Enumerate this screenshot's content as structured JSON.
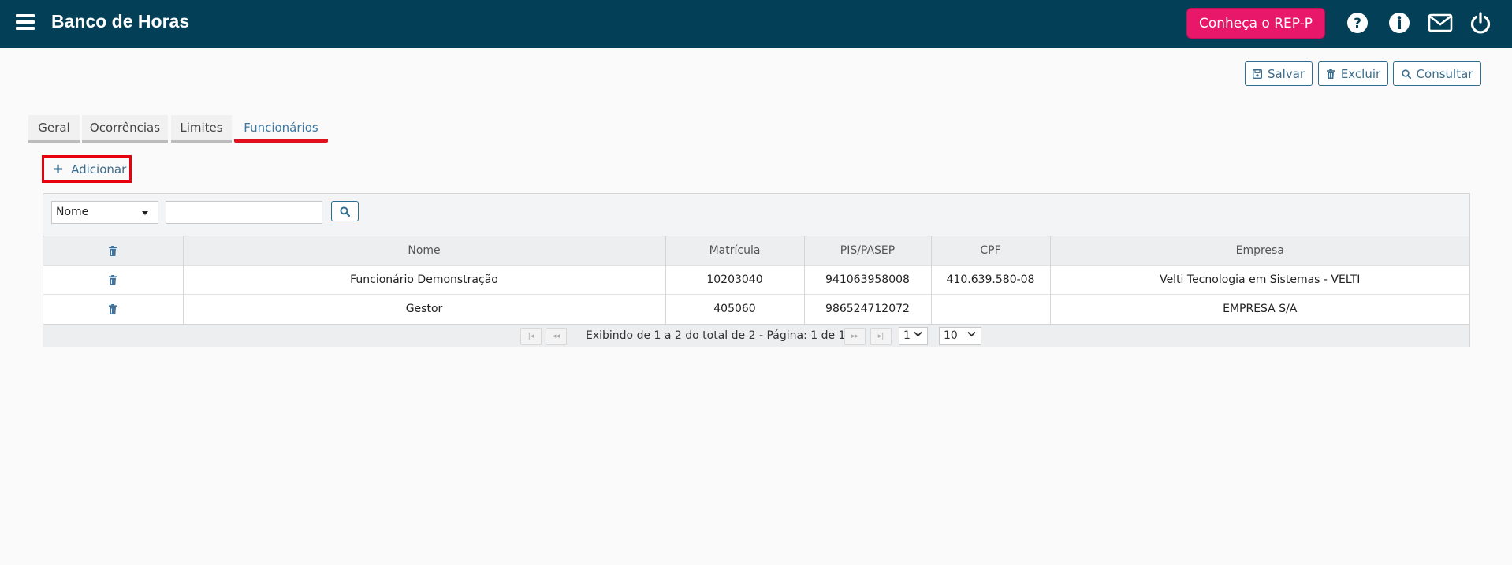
{
  "header": {
    "title": "Banco de Horas",
    "promo_label": "Conheça o REP-P",
    "icons": [
      "menu-icon",
      "help-icon",
      "info-icon",
      "mail-icon",
      "power-icon"
    ],
    "brand_color": "#033f56",
    "promo_color": "#e8176a"
  },
  "actions": {
    "save_label": "Salvar",
    "delete_label": "Excluir",
    "query_label": "Consultar"
  },
  "tabs": [
    {
      "label": "Geral",
      "active": false
    },
    {
      "label": "Ocorrências",
      "active": false
    },
    {
      "label": "Limites",
      "active": false
    },
    {
      "label": "Funcionários",
      "active": true
    }
  ],
  "add_label": "Adicionar",
  "filter": {
    "field_value": "Nome",
    "search_value": ""
  },
  "table": {
    "columns": [
      "Nome",
      "Matrícula",
      "PIS/PASEP",
      "CPF",
      "Empresa"
    ],
    "rows": [
      {
        "nome": "Funcionário Demonstração",
        "matricula": "10203040",
        "pis": "941063958008",
        "cpf": "410.639.580-08",
        "empresa": "Velti Tecnologia em Sistemas - VELTI"
      },
      {
        "nome": "Gestor",
        "matricula": "405060",
        "pis": "986524712072",
        "cpf": "",
        "empresa": "EMPRESA S/A"
      }
    ]
  },
  "pager": {
    "status": "Exibindo de 1 a 2 do total de 2 - Página: 1 de 1",
    "page_value": "1",
    "page_size_value": "10"
  }
}
